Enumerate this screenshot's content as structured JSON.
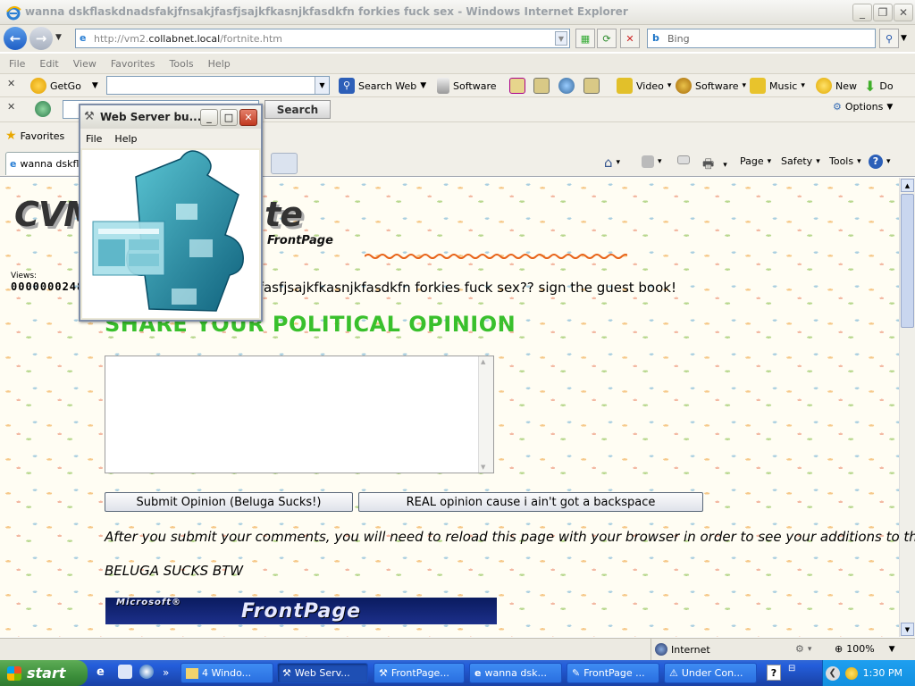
{
  "window": {
    "title": "wanna dskflaskdnadsfakjfnsakjfasfjsajkfkasnjkfasdkfn forkies fuck sex - Windows Internet Explorer",
    "minimize": "_",
    "maximize": "❐",
    "close": "✕"
  },
  "address": {
    "prefix": "http://vm2.",
    "host": "collabnet.local",
    "path": "/fortnite.htm",
    "search_placeholder": "Bing"
  },
  "menu": [
    "File",
    "Edit",
    "View",
    "Favorites",
    "Tools",
    "Help"
  ],
  "toolbar1": {
    "getgo": "GetGo",
    "search_web": "Search Web",
    "software": "Software",
    "video": "Video",
    "software2": "Software",
    "music": "Music",
    "new": "New",
    "download": "Do"
  },
  "toolbar2": {
    "search_button": "Search",
    "options": "Options"
  },
  "favorites": {
    "label": "Favorites"
  },
  "tab": {
    "label": "wanna dskfla"
  },
  "commandbar": {
    "page": "Page",
    "safety": "Safety",
    "tools": "Tools"
  },
  "popup": {
    "title": "Web Server bu...",
    "menu": [
      "File",
      "Help"
    ]
  },
  "page": {
    "logo": "CVM",
    "logo_tail": "te",
    "logo_sub": "le in FrontPage",
    "views_label": "Views:",
    "views_count": "0000000248",
    "guest_line": "nsakjfasfjsajkfkasnjkfasdkfn forkies fuck sex?? sign the guest book!",
    "heading": "SHARE YOUR POLITICAL OPINION",
    "submit_button": "Submit Opinion (Beluga Sucks!)",
    "real_button": "REAL opinion cause i ain't got a backspace",
    "note": "After you submit your comments, you will need to reload this page with your browser in order to see your additions to the log.",
    "beluga": "BELUGA SUCKS BTW",
    "banner": "FrontPage",
    "banner_small": "Microsoft®"
  },
  "status": {
    "zone": "Internet",
    "zoom": "100%"
  },
  "taskbar": {
    "start": "start",
    "tasks": [
      "4 Windo...",
      "Web Serv...",
      "FrontPage...",
      "wanna dsk...",
      "FrontPage ...",
      "Under Con..."
    ],
    "clock": "1:30 PM"
  },
  "colors": {
    "heading_green": "#39c02c",
    "taskbar_blue": "#245edb",
    "start_green": "#3c8f3b"
  }
}
